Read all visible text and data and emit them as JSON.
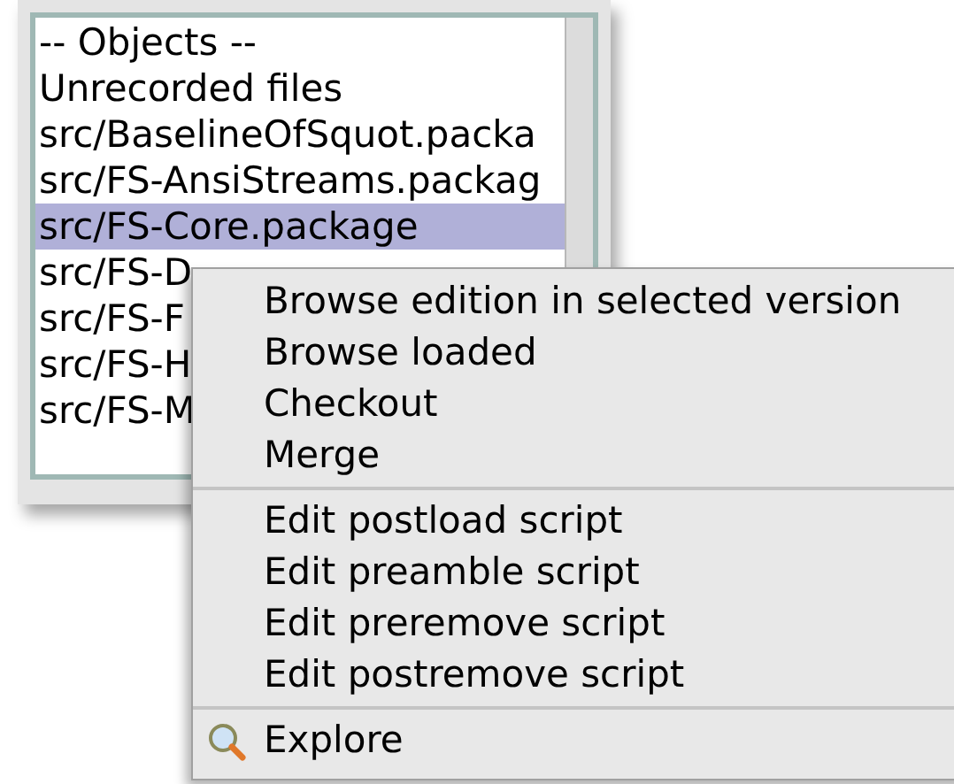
{
  "list": {
    "items": [
      {
        "label": "-- Objects --",
        "selected": false
      },
      {
        "label": "Unrecorded files",
        "selected": false
      },
      {
        "label": "src/BaselineOfSquot.packa",
        "selected": false
      },
      {
        "label": "src/FS-AnsiStreams.packag",
        "selected": false
      },
      {
        "label": "src/FS-Core.package",
        "selected": true
      },
      {
        "label": "src/FS-D",
        "selected": false
      },
      {
        "label": "src/FS-F",
        "selected": false
      },
      {
        "label": "src/FS-H",
        "selected": false
      },
      {
        "label": "src/FS-M",
        "selected": false
      }
    ]
  },
  "context_menu": {
    "groups": [
      [
        {
          "label": "Browse edition in selected version",
          "kind": "plain"
        },
        {
          "label": "Browse loaded",
          "kind": "plain"
        },
        {
          "label": "Checkout",
          "kind": "plain"
        },
        {
          "label": "Merge",
          "kind": "plain"
        }
      ],
      [
        {
          "label": "Edit postload script",
          "kind": "plain"
        },
        {
          "label": "Edit preamble script",
          "kind": "plain"
        },
        {
          "label": "Edit preremove script",
          "kind": "plain"
        },
        {
          "label": "Edit postremove script",
          "kind": "plain"
        }
      ],
      [
        {
          "label": "Explore",
          "kind": "search"
        }
      ]
    ]
  }
}
